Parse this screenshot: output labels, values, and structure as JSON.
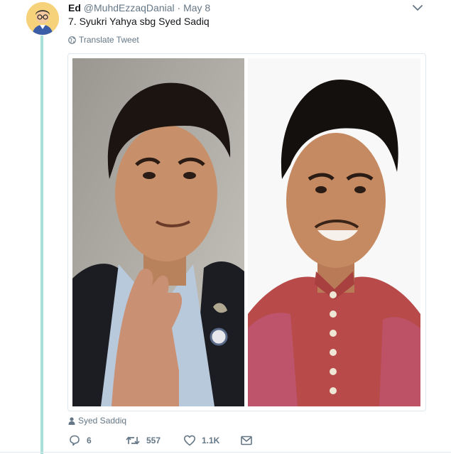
{
  "tweet": {
    "author_name": "Ed",
    "author_handle": "@MuhdEzzaqDanial",
    "separator": "·",
    "date": "May 8",
    "text": "7. Syukri Yahya sbg Syed Sadiq",
    "translate_label": "Translate Tweet",
    "tagged_user": "Syed Saddiq"
  },
  "actions": {
    "replies": "6",
    "retweets": "557",
    "likes": "1.1K"
  },
  "colors": {
    "thread_line": "#a8dfd9",
    "meta_text": "#657786",
    "avatar_bg": "#f6d27a"
  },
  "icons": {
    "caret": "chevron-down-icon",
    "translate": "globe-icon",
    "tagged": "person-icon",
    "reply": "reply-icon",
    "retweet": "retweet-icon",
    "like": "heart-icon",
    "dm": "envelope-icon"
  }
}
